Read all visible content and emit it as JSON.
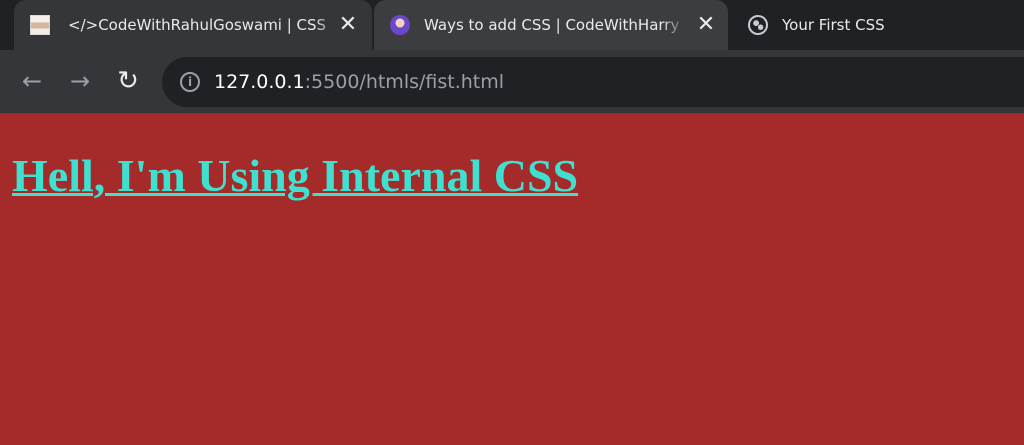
{
  "browser": {
    "tabs": [
      {
        "title": "</>CodeWithRahulGoswami | CSS",
        "favicon": "avatar-icon",
        "close": "✕"
      },
      {
        "title": "Ways to add CSS | CodeWithHarry",
        "favicon": "avatar-icon",
        "close": "✕"
      },
      {
        "title": "Your First CSS",
        "favicon": "globe-icon"
      }
    ],
    "toolbar": {
      "back_icon": "←",
      "forward_icon": "→",
      "reload_icon": "↻",
      "info_icon": "i"
    },
    "address_bar": {
      "host": "127.0.0.1",
      "path": ":5500/htmls/fist.html"
    },
    "colors": {
      "tabbar_background": "#202124",
      "active_tab_background": "#35363a",
      "omnibox_background": "#202124",
      "page_background": "#a52a2a",
      "heading_color": "#40e0d0"
    }
  },
  "page": {
    "heading": "Hell, I'm Using Internal CSS"
  }
}
